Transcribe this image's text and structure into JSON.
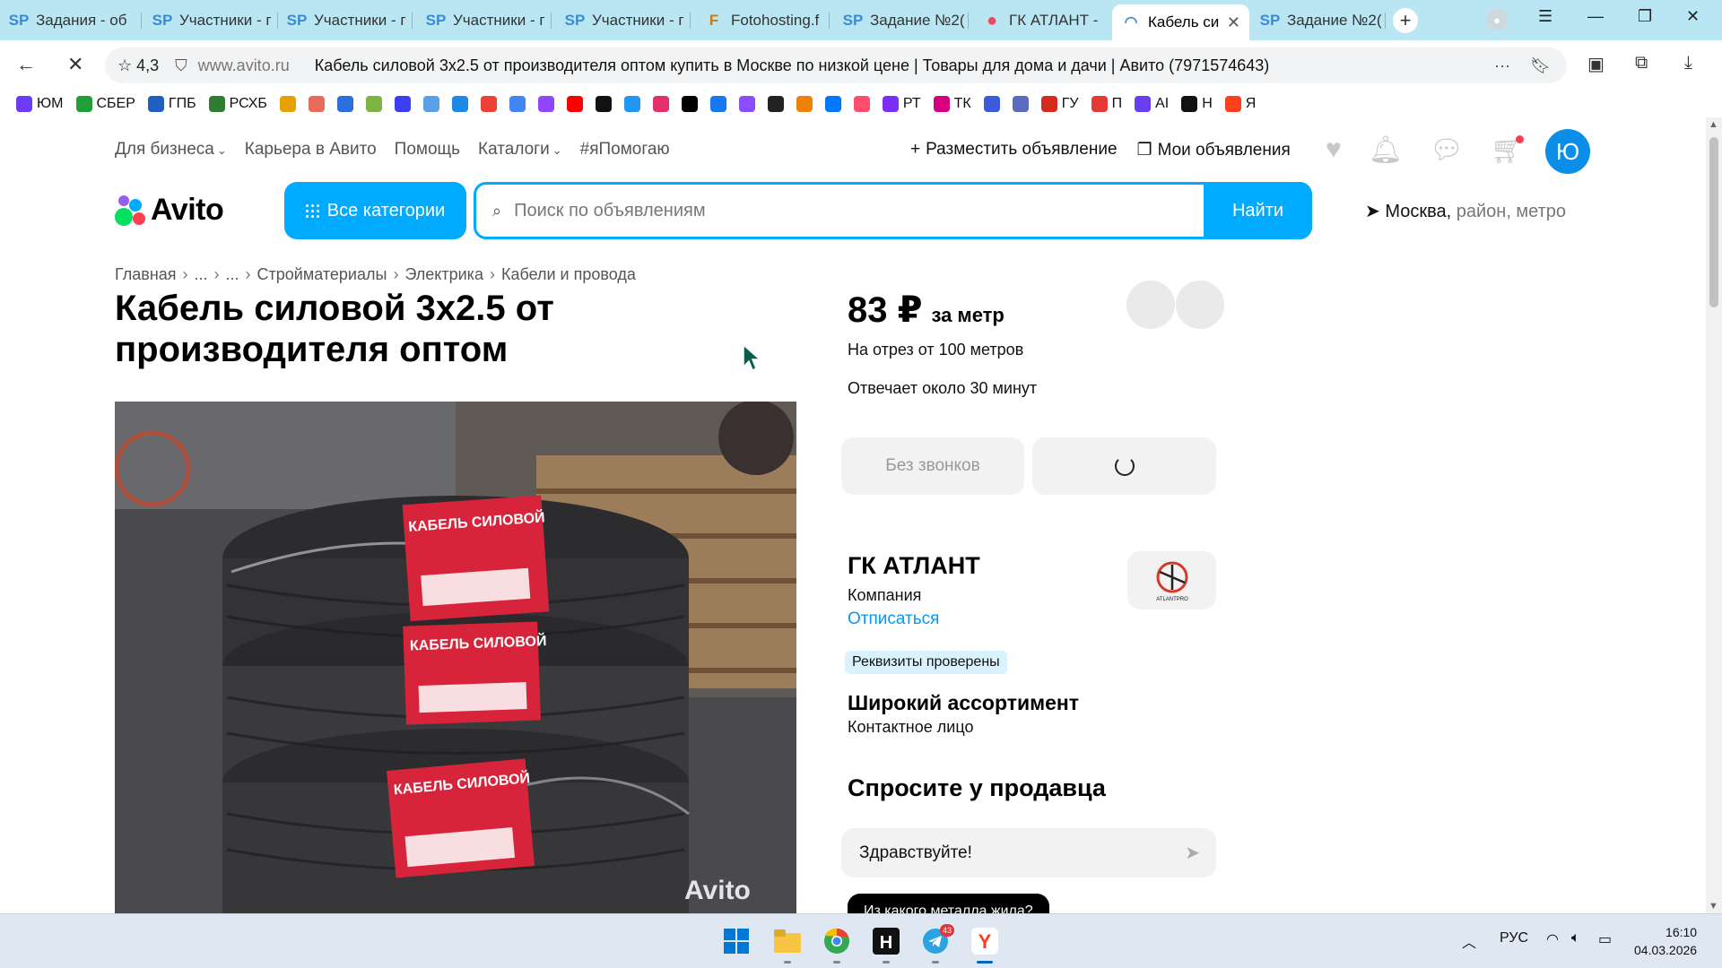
{
  "browser": {
    "tabs": [
      {
        "icon": "SP",
        "label": "Задания - об"
      },
      {
        "icon": "SP",
        "label": "Участники - г"
      },
      {
        "icon": "SP",
        "label": "Участники - г"
      },
      {
        "icon": "SP",
        "label": "Участники - г"
      },
      {
        "icon": "SP",
        "label": "Участники - г"
      },
      {
        "icon": "F",
        "label": "Fotohosting.f"
      },
      {
        "icon": "SP",
        "label": "Задание №2("
      },
      {
        "icon": "●",
        "label": "ГК АТЛАНТ -"
      },
      {
        "icon": "◠",
        "label": "Кабель си"
      },
      {
        "icon": "SP",
        "label": "Задание №2("
      }
    ],
    "active_tab_close": "✕",
    "new_tab": "+",
    "address": {
      "rating": "4,3",
      "host": "www.avito.ru",
      "page_title": "Кабель силовой 3х2.5 от производителя оптом купить в Москве по низкой цене | Товары для дома и дачи | Авито (7971574643)"
    },
    "bookmarks": [
      {
        "label": "ЮМ",
        "color": "#6b3bf5"
      },
      {
        "label": "СБЕР",
        "color": "#21a038"
      },
      {
        "label": "ГПБ",
        "color": "#1f5fbf"
      },
      {
        "label": "РСХБ",
        "color": "#2e7d32"
      },
      {
        "label": "",
        "color": "#e6a100"
      },
      {
        "label": "",
        "color": "#e86a5c"
      },
      {
        "label": "",
        "color": "#2a6fdb"
      },
      {
        "label": "",
        "color": "#7cb342"
      },
      {
        "label": "",
        "color": "#3d3df5"
      },
      {
        "label": "",
        "color": "#5aa0e6"
      },
      {
        "label": "",
        "color": "#1e88e5"
      },
      {
        "label": "",
        "color": "#ea4335"
      },
      {
        "label": "",
        "color": "#4285f4"
      },
      {
        "label": "",
        "color": "#9146ff"
      },
      {
        "label": "",
        "color": "#ff0000"
      },
      {
        "label": "",
        "color": "#111111"
      },
      {
        "label": "",
        "color": "#2196f3"
      },
      {
        "label": "",
        "color": "#e1306c"
      },
      {
        "label": "",
        "color": "#000000"
      },
      {
        "label": "",
        "color": "#1877f2"
      },
      {
        "label": "",
        "color": "#8a4dff"
      },
      {
        "label": "",
        "color": "#222222"
      },
      {
        "label": "",
        "color": "#ee8208"
      },
      {
        "label": "",
        "color": "#0077ff"
      },
      {
        "label": "",
        "color": "#ff4d6d"
      },
      {
        "label": "РТ",
        "color": "#7b2ff7"
      },
      {
        "label": "ТК",
        "color": "#d6007f"
      },
      {
        "label": "",
        "color": "#3b5bdb"
      },
      {
        "label": "",
        "color": "#5c6bc0"
      },
      {
        "label": "ГУ",
        "color": "#d52b1e"
      },
      {
        "label": "П",
        "color": "#e53935"
      },
      {
        "label": "AI",
        "color": "#6a3df0"
      },
      {
        "label": "Н",
        "color": "#111111"
      },
      {
        "label": "Я",
        "color": "#fc3f1d"
      }
    ]
  },
  "site": {
    "top_nav": [
      {
        "label": "Для бизнеса",
        "has_chevron": true
      },
      {
        "label": "Карьера в Авито",
        "has_chevron": false
      },
      {
        "label": "Помощь",
        "has_chevron": false
      },
      {
        "label": "Каталоги",
        "has_chevron": true
      },
      {
        "label": "#яПомогаю",
        "has_chevron": false
      }
    ],
    "post_ad": "Разместить объявление",
    "my_ads": "Мои объявления",
    "avatar_letter": "Ю",
    "logo_text": "Avito",
    "all_categories": "Все категории",
    "search_placeholder": "Поиск по объявлениям",
    "search_button": "Найти",
    "location_city": "Москва,",
    "location_hint": " район, метро",
    "brand_colors": {
      "primary": "#00aaff",
      "link": "#0099f7",
      "badge_bg": "#d9f2fe"
    }
  },
  "listing": {
    "breadcrumbs": [
      "Главная",
      "...",
      "...",
      "Стройматериалы",
      "Электрика",
      "Кабели и провода"
    ],
    "title": "Кабель силовой 3х2.5 от производителя оптом",
    "photo_labels": [
      "КАБЕЛЬ СИЛОВОЙ",
      "КАБЕЛЬ СИЛОВОЙ",
      "КАБЕЛЬ СИЛОВОЙ"
    ],
    "photo_watermark": "Avito",
    "price": "83 ₽",
    "price_unit": "за метр",
    "price_note": "На отрез от 100 метров",
    "reply_time": "Отвечает около 30 минут",
    "no_calls_button": "Без звонков",
    "seller": {
      "name": "ГК АТЛАНТ",
      "type": "Компания",
      "unsubscribe": "Отписаться",
      "verified_badge": "Реквизиты проверены",
      "logo_text": "ATLANTPRO"
    },
    "slogan": "Широкий ассортимент",
    "contact_label": "Контактное лицо",
    "ask_title": "Спросите у продавца",
    "message_value": "Здравствуйте!",
    "suggested_question": "Из какого металла жила?"
  },
  "taskbar": {
    "telegram_badge": "43",
    "language": "РУС",
    "time": "16:10",
    "date": "04.03.2026"
  }
}
